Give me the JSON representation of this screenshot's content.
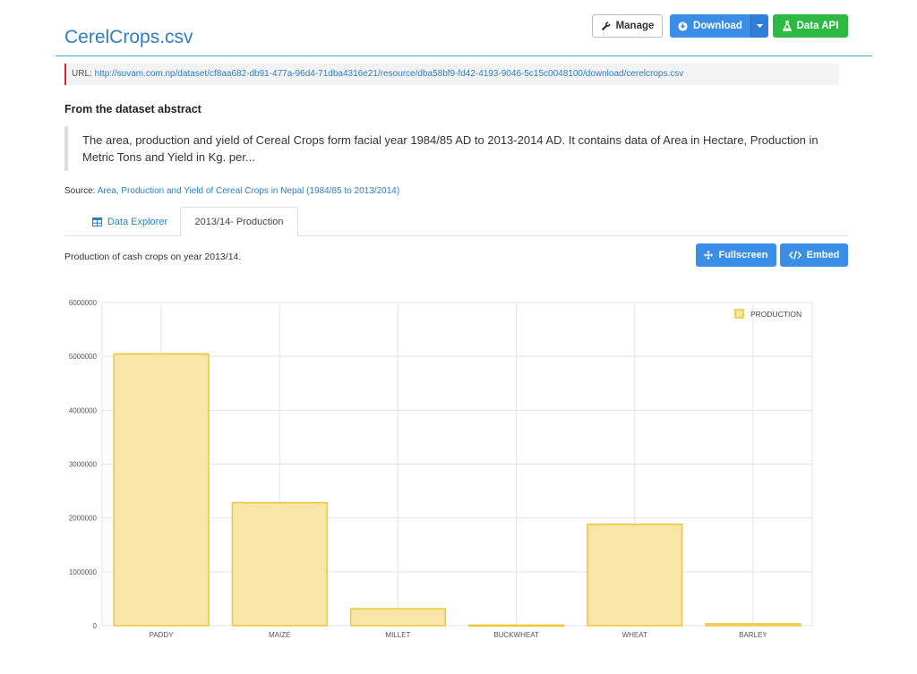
{
  "page": {
    "title": "CerelCrops.csv",
    "url_label": "URL:",
    "url": "http://suvam.com.np/dataset/cf8aa682-db91-477a-96d4-71dba4316e21/resource/dba58bf9-fd42-4193-9046-5c15c0048100/download/cerelcrops.csv",
    "abstract_heading": "From the dataset abstract",
    "abstract_text": "The area, production and yield of Cereal Crops form facial year 1984/85 AD to 2013-2014 AD. It contains data of Area in Hectare, Production in Metric Tons and Yield in Kg. per...",
    "source_label": "Source:",
    "source_link": "Area, Production and Yield of Cereal Crops in Nepal (1984/85 to 2013/2014)",
    "view_description": "Production of cash crops on year 2013/14."
  },
  "toolbar": {
    "manage": "Manage",
    "download": "Download",
    "data_api": "Data API",
    "fullscreen": "Fullscreen",
    "embed": "Embed"
  },
  "tabs": [
    {
      "label": "Data Explorer",
      "icon": "table-icon",
      "active": false
    },
    {
      "label": "2013/14- Production",
      "active": true
    }
  ],
  "colors": {
    "link": "#2f7ebd",
    "primary_button": "#3a8ee6",
    "api_button": "#2eb844",
    "bar_fill": "#f8e5a8",
    "bar_stroke": "#f0c52e"
  },
  "chart_data": {
    "type": "bar",
    "categories": [
      "PADDY",
      "MAIZE",
      "MILLET",
      "BUCKWHEAT",
      "WHEAT",
      "BARLEY"
    ],
    "series": [
      {
        "name": "PRODUCTION",
        "values": [
          5047047,
          2283274,
          314715,
          10000,
          1883147,
          35000
        ]
      }
    ],
    "ylim": [
      0,
      6000000
    ],
    "yticks": [
      0,
      1000000,
      2000000,
      3000000,
      4000000,
      5000000,
      6000000
    ],
    "legend_position": "top-right",
    "grid": true
  }
}
